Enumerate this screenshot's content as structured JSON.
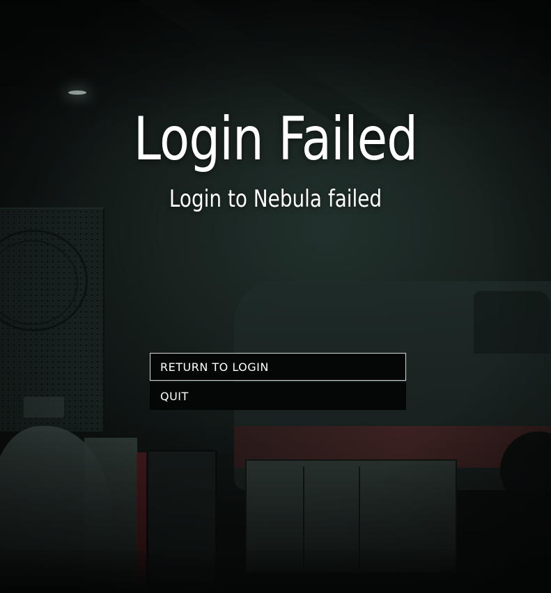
{
  "dialog": {
    "title": "Login Failed",
    "message": "Login to Nebula failed"
  },
  "menu": {
    "items": [
      {
        "label": "RETURN TO LOGIN",
        "selected": true
      },
      {
        "label": "QUIT",
        "selected": false
      }
    ]
  },
  "colors": {
    "text": "#ffffff",
    "button_bg": "#050707",
    "selected_border": "#d7dcdb"
  }
}
